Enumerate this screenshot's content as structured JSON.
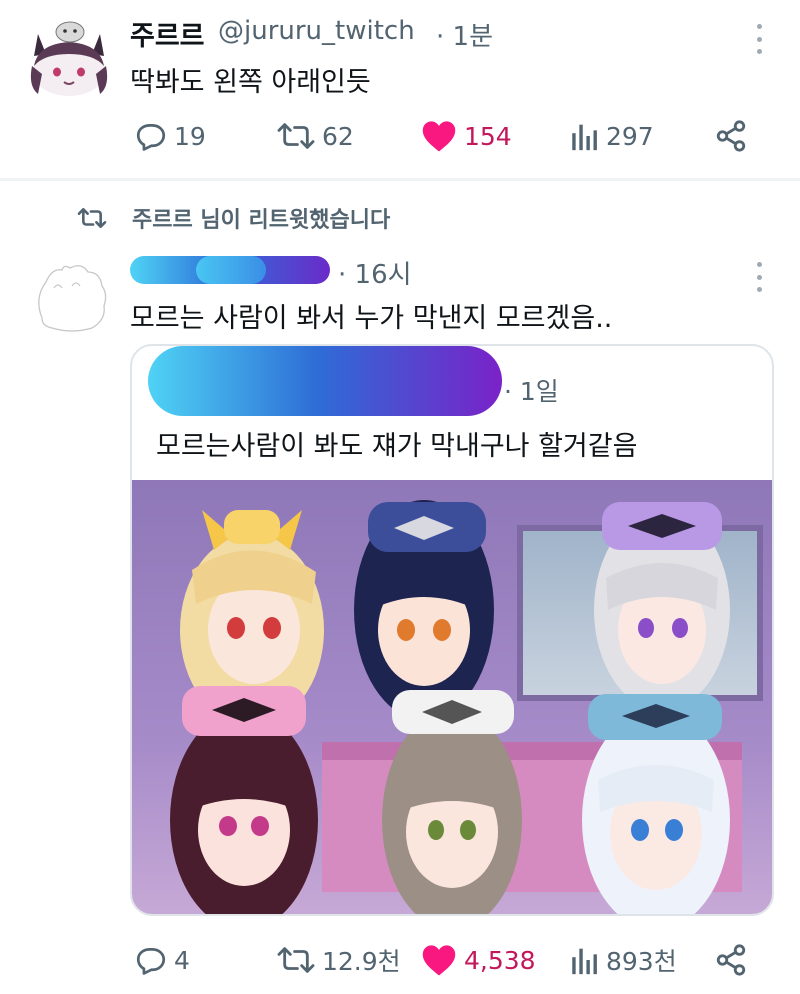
{
  "tweet1": {
    "display_name": "주르르",
    "handle": "@jururu_twitch",
    "time": "· 1분",
    "text": "딱봐도 왼쪽 아래인듯",
    "replies": "19",
    "retweets": "62",
    "likes": "154",
    "views": "297",
    "liked": true
  },
  "retweet_header": "주르르 님이 리트윗했습니다",
  "tweet2": {
    "time": "· 16시",
    "text": "모르는 사람이 봐서 누가 막낸지 모르겠음..",
    "quote": {
      "time": "· 1일",
      "text": "모르는사람이 봐도 쟤가 막내구나 할거같음"
    },
    "replies": "4",
    "retweets": "12.9천",
    "likes": "4,538",
    "views": "893천"
  },
  "colors": {
    "text_primary": "#0f1419",
    "text_secondary": "#536471",
    "like_pink": "#f91880",
    "like_count": "#c3185b",
    "divider": "#eff3f4"
  },
  "icons": [
    "reply-icon",
    "retweet-icon",
    "heart-icon",
    "views-icon",
    "share-icon",
    "more-icon"
  ]
}
